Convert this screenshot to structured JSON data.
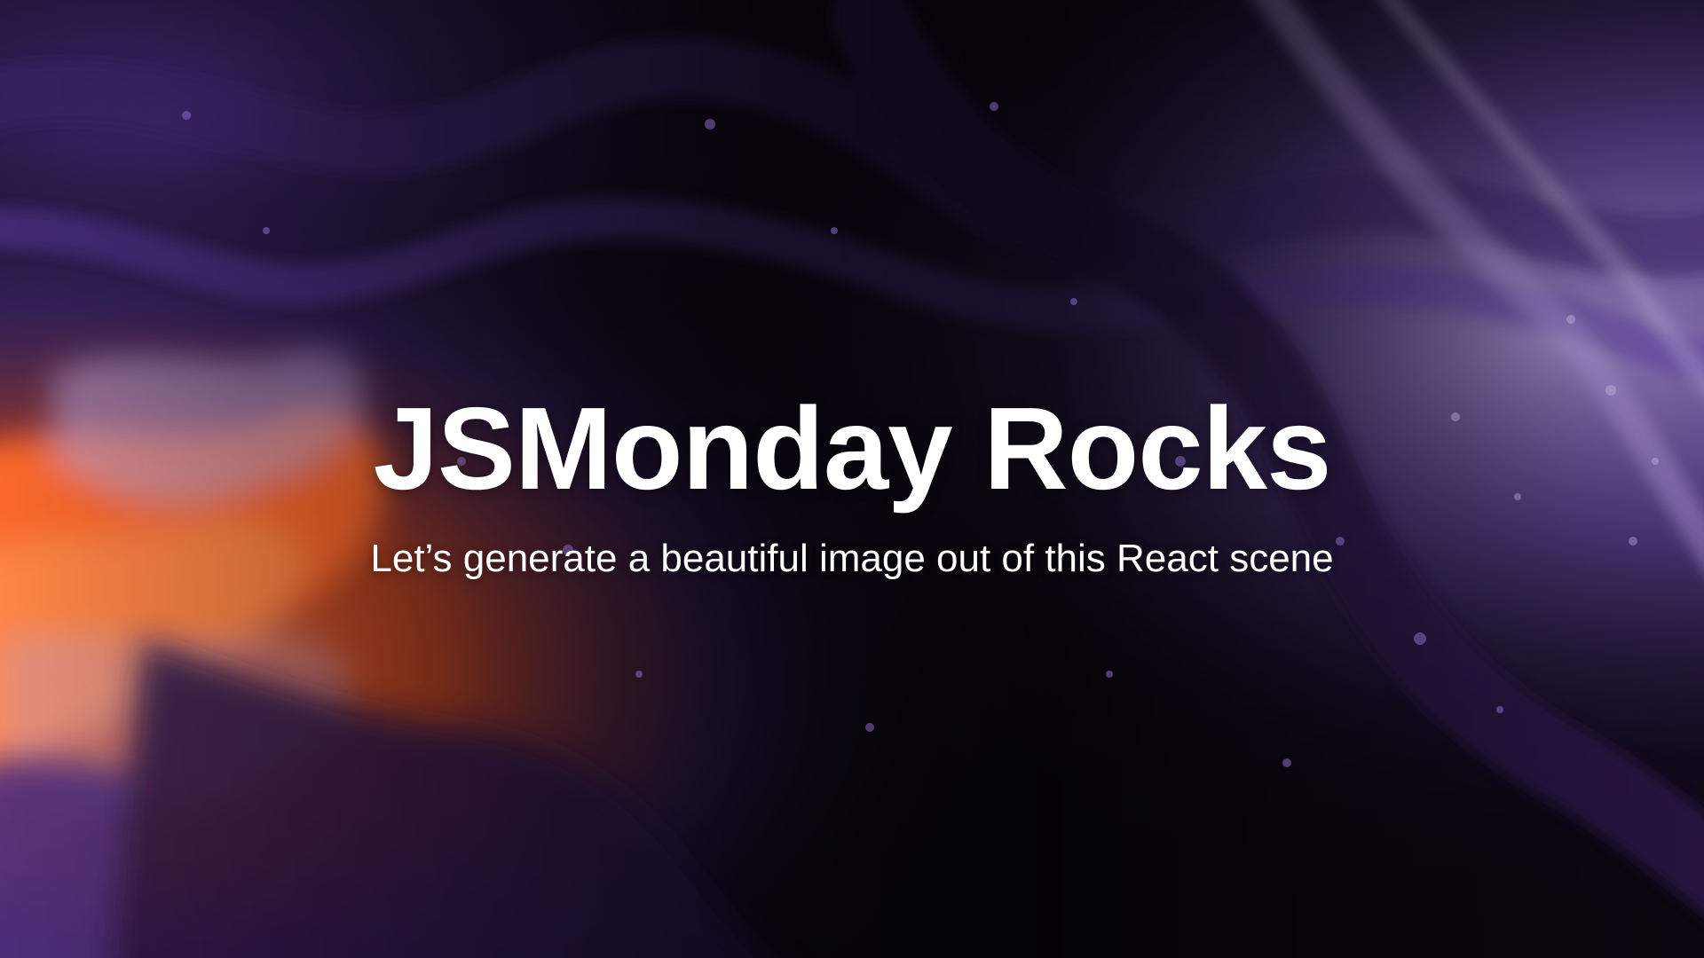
{
  "hero": {
    "title": "JSMonday Rocks",
    "subtitle": "Let’s generate a beautiful image out of this React scene"
  },
  "background": {
    "description_colors": {
      "base_dark": "#0b0710",
      "purple_deep": "#2b174a",
      "purple_mid": "#4a2f85",
      "purple_light": "#8a6bc2",
      "lavender": "#b9a6dc",
      "orange": "#ff6a2b",
      "orange_light": "#ff9a5a"
    }
  }
}
